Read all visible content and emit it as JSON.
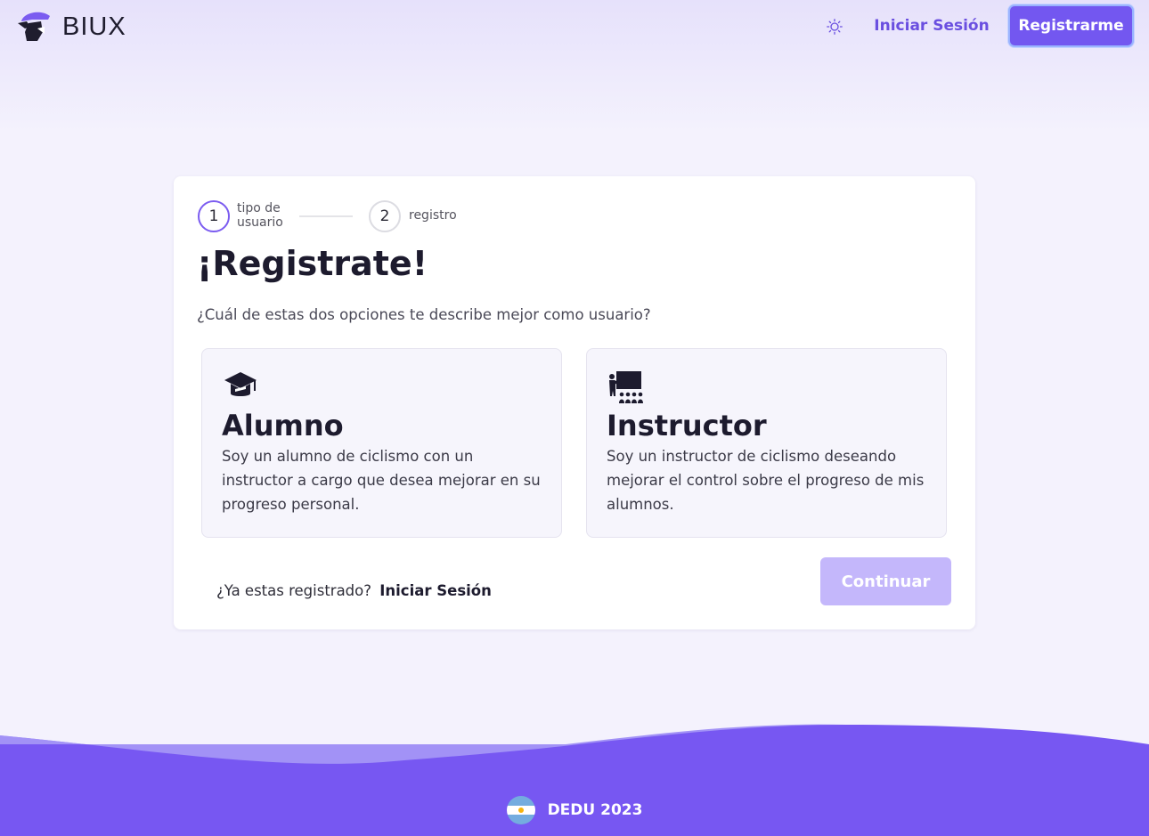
{
  "header": {
    "logo_text": "BIUX",
    "theme_icon": "sun-icon",
    "login_label": "Iniciar Sesión",
    "register_label": "Registrarme"
  },
  "stepper": {
    "steps": [
      {
        "number": "1",
        "label": "tipo de usuario",
        "active": true
      },
      {
        "number": "2",
        "label": "registro",
        "active": false
      }
    ]
  },
  "card": {
    "title": "¡Registrate!",
    "subtitle": "¿Cuál de estas dos opciones te describe mejor como usuario?",
    "options": [
      {
        "icon": "graduation-cap-icon",
        "title": "Alumno",
        "description": "Soy un alumno de ciclismo con un instructor a cargo que desea mejorar en su progreso personal."
      },
      {
        "icon": "chalkboard-teacher-icon",
        "title": "Instructor",
        "description": "Soy un instructor de ciclismo deseando mejorar el control sobre el progreso de mis alumnos."
      }
    ],
    "already_registered": "¿Ya estas registrado?",
    "login_link": "Iniciar Sesión",
    "continue_label": "Continuar"
  },
  "footer": {
    "flag_icon": "argentina-flag-icon",
    "text": "DEDU 2023"
  },
  "colors": {
    "primary": "#7357f0",
    "primary_light": "#c4b7fb",
    "background": "#f4f2fd",
    "footer": "#7757f2"
  }
}
